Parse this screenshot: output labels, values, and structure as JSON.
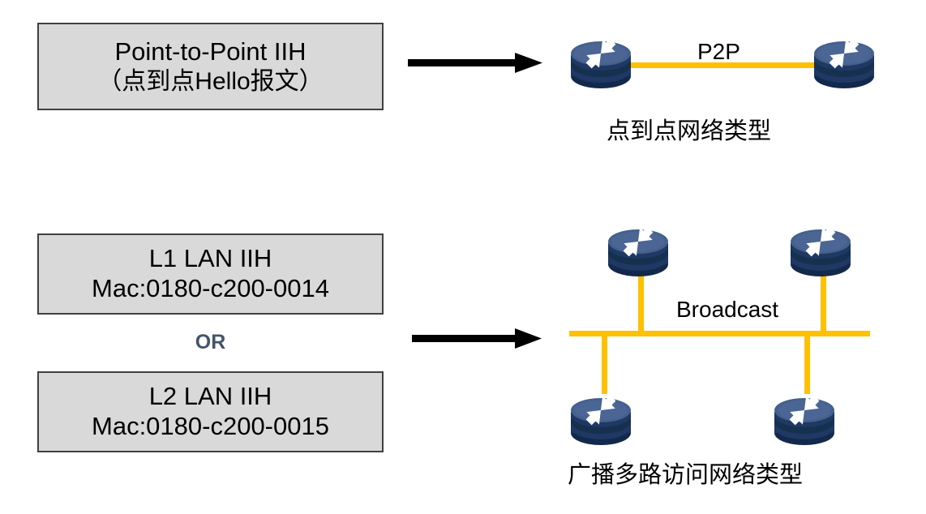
{
  "diagram": {
    "title_colors": {
      "box_fill": "#d9d9d9",
      "box_border": "#404040",
      "link": "#ffc000",
      "router_body": "#1f3864",
      "router_top": "#44618c",
      "or_text": "#44546a",
      "arrow": "#000000"
    },
    "rows": [
      {
        "id": "p2p",
        "box": {
          "line1": "Point-to-Point IIH",
          "line2": "（点到点Hello报文）"
        },
        "arrow_icon": "right-arrow-icon",
        "topology": {
          "link_label": "P2P",
          "caption": "点到点网络类型",
          "routers": [
            "router-p2p-left",
            "router-p2p-right"
          ]
        }
      },
      {
        "id": "broadcast",
        "box_1": {
          "line1": "L1 LAN IIH",
          "line2": "Mac:0180-c200-0014"
        },
        "separator": "OR",
        "box_2": {
          "line1": "L2 LAN IIH",
          "line2": "Mac:0180-c200-0015"
        },
        "arrow_icon": "right-arrow-icon",
        "topology": {
          "link_label": "Broadcast",
          "caption": "广播多路访问网络类型",
          "routers": [
            "router-top-left",
            "router-top-right",
            "router-bottom-left",
            "router-bottom-right"
          ]
        }
      }
    ]
  }
}
